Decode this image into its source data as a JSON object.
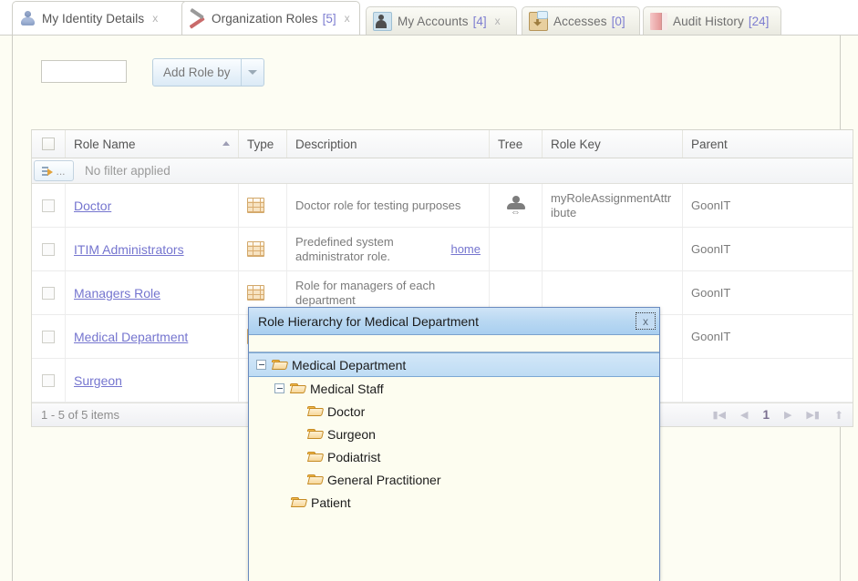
{
  "tabs": [
    {
      "label": "My Identity Details",
      "count": null,
      "icon": "person-icon",
      "closable": true,
      "active": false
    },
    {
      "label": "Organization Roles",
      "count": "[5]",
      "icon": "tools-icon",
      "closable": true,
      "active": true
    },
    {
      "label": "My Accounts",
      "count": "[4]",
      "icon": "accounts-icon",
      "closable": true,
      "active": false
    },
    {
      "label": "Accesses",
      "count": "[0]",
      "icon": "accesses-icon",
      "closable": false,
      "active": false
    },
    {
      "label": "Audit History",
      "count": "[24]",
      "icon": "audit-icon",
      "closable": false,
      "active": false
    }
  ],
  "tab_close_label": "x",
  "toolbar": {
    "search_value": "",
    "search_placeholder": "",
    "add_role_label": "Add Role by",
    "dropdown_arrow": "chevron-down-icon"
  },
  "grid": {
    "columns": [
      {
        "key": "checkbox",
        "label": ""
      },
      {
        "key": "name",
        "label": "Role Name",
        "sorted": "asc"
      },
      {
        "key": "type",
        "label": "Type"
      },
      {
        "key": "desc",
        "label": "Description"
      },
      {
        "key": "tree",
        "label": "Tree"
      },
      {
        "key": "rolekey",
        "label": "Role Key"
      },
      {
        "key": "parent",
        "label": "Parent"
      }
    ],
    "filter_row": {
      "button_label": "...",
      "text": "No filter applied"
    },
    "rows": [
      {
        "name": "Doctor",
        "type_icon": "brick-wall-icon",
        "desc": "Doctor role for testing purposes",
        "desc_link": "",
        "tree_icon": "person-hierarchy-icon",
        "tree_selected": false,
        "rolekey": "myRoleAssignmentAttribute",
        "parent": "GoonIT"
      },
      {
        "name": "ITIM Administrators",
        "type_icon": "brick-wall-icon",
        "desc": "Predefined system administrator role.",
        "desc_link": "home",
        "tree_icon": "",
        "tree_selected": false,
        "rolekey": "",
        "parent": "GoonIT"
      },
      {
        "name": "Managers Role",
        "type_icon": "brick-wall-icon",
        "desc": "Role for managers of each department",
        "desc_link": "",
        "tree_icon": "",
        "tree_selected": false,
        "rolekey": "",
        "parent": "GoonIT"
      },
      {
        "name": "Medical Department",
        "type_icon": "brick-wall-icon",
        "desc": "",
        "desc_link": "",
        "tree_icon": "person-icon",
        "tree_selected": true,
        "rolekey": "",
        "parent": "GoonIT"
      },
      {
        "name": "Surgeon",
        "type_icon": "",
        "desc": "",
        "desc_link": "",
        "tree_icon": "",
        "tree_selected": false,
        "rolekey": "",
        "parent": ""
      }
    ],
    "footer": {
      "items_text": "1 - 5 of 5 items",
      "first_icon": "first-page-icon",
      "prev_icon": "prev-page-icon",
      "page_number": "1",
      "next_icon": "next-page-icon",
      "last_icon": "last-page-icon",
      "refresh_icon": "scroll-up-icon"
    }
  },
  "dialog": {
    "title": "Role Hierarchy for Medical Department",
    "close_label": "x",
    "tree": [
      {
        "label": "Medical Department",
        "depth": 0,
        "expander": "minus",
        "selected": true
      },
      {
        "label": "Medical Staff",
        "depth": 1,
        "expander": "minus",
        "selected": false
      },
      {
        "label": "Doctor",
        "depth": 2,
        "expander": "none",
        "selected": false
      },
      {
        "label": "Surgeon",
        "depth": 2,
        "expander": "none",
        "selected": false
      },
      {
        "label": "Podiatrist",
        "depth": 2,
        "expander": "none",
        "selected": false
      },
      {
        "label": "General Practitioner",
        "depth": 2,
        "expander": "none",
        "selected": false
      },
      {
        "label": "Patient",
        "depth": 1,
        "expander": "none",
        "selected": false
      }
    ]
  },
  "colors": {
    "accent_link": "#7575cf",
    "dialog_title_bg": "#bedcf4",
    "page_bg": "#fdfdf3",
    "brick": "#f2d7ae"
  }
}
